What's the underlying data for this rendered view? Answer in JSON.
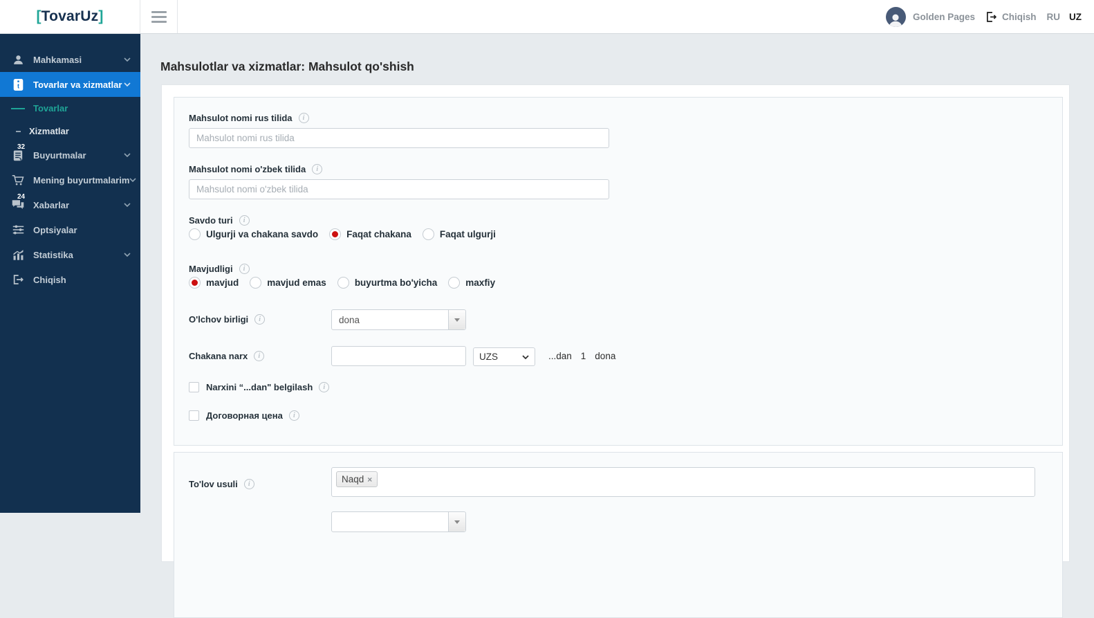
{
  "colors": {
    "accent_blue": "#1178d4",
    "sidebar_navy": "#12304f",
    "brand_teal": "#1fa597",
    "radio_red": "#cc0f0f",
    "content_bg": "#e7ebee"
  },
  "logo": {
    "open": "[",
    "name": "TovarUz",
    "close": "]"
  },
  "header": {
    "user_name": "Golden Pages",
    "logout_label": "Chiqish",
    "lang_ru": "RU",
    "lang_uz": "UZ"
  },
  "sidebar": {
    "items": [
      {
        "label": "Mahkamasi"
      },
      {
        "label": "Tovarlar va xizmatlar"
      },
      {
        "label": "Tovarlar"
      },
      {
        "label": "Xizmatlar"
      },
      {
        "label": "Buyurtmalar",
        "badge": "32"
      },
      {
        "label": "Mening buyurtmalarim"
      },
      {
        "label": "Xabarlar",
        "badge": "24"
      },
      {
        "label": "Optsiyalar"
      },
      {
        "label": "Statistika"
      },
      {
        "label": "Chiqish"
      }
    ]
  },
  "page": {
    "title": "Mahsulotlar va xizmatlar: Mahsulot qo'shish"
  },
  "icons": {
    "info": "i"
  },
  "form": {
    "name_ru": {
      "label": "Mahsulot nomi rus tilida",
      "placeholder": "Mahsulot nomi rus tilida",
      "value": ""
    },
    "name_uz": {
      "label": "Mahsulot nomi o'zbek tilida",
      "placeholder": "Mahsulot nomi o'zbek tilida",
      "value": ""
    },
    "savdo_turi": {
      "label": "Savdo turi",
      "options": [
        "Ulgurji va chakana savdo",
        "Faqat chakana",
        "Faqat ulgurji"
      ],
      "selected": "Faqat chakana"
    },
    "mavjudligi": {
      "label": "Mavjudligi",
      "options": [
        "mavjud",
        "mavjud emas",
        "buyurtma bo'yicha",
        "maxfiy"
      ],
      "selected": "mavjud"
    },
    "olchov": {
      "label": "O'lchov birligi",
      "value": "dona"
    },
    "chakana_narx": {
      "label": "Chakana narx",
      "value": "",
      "currency": "UZS",
      "suffix_dan": "...dan",
      "suffix_qty": "1",
      "suffix_unit": "dona"
    },
    "checkbox_dan": {
      "label": "Narxini “...dan\" belgilash",
      "checked": false
    },
    "checkbox_dogovor": {
      "label": "Договорная цена",
      "checked": false
    },
    "tolov": {
      "label": "To'lov usuli",
      "tags": [
        "Naqd"
      ],
      "remove_glyph": "×"
    }
  }
}
